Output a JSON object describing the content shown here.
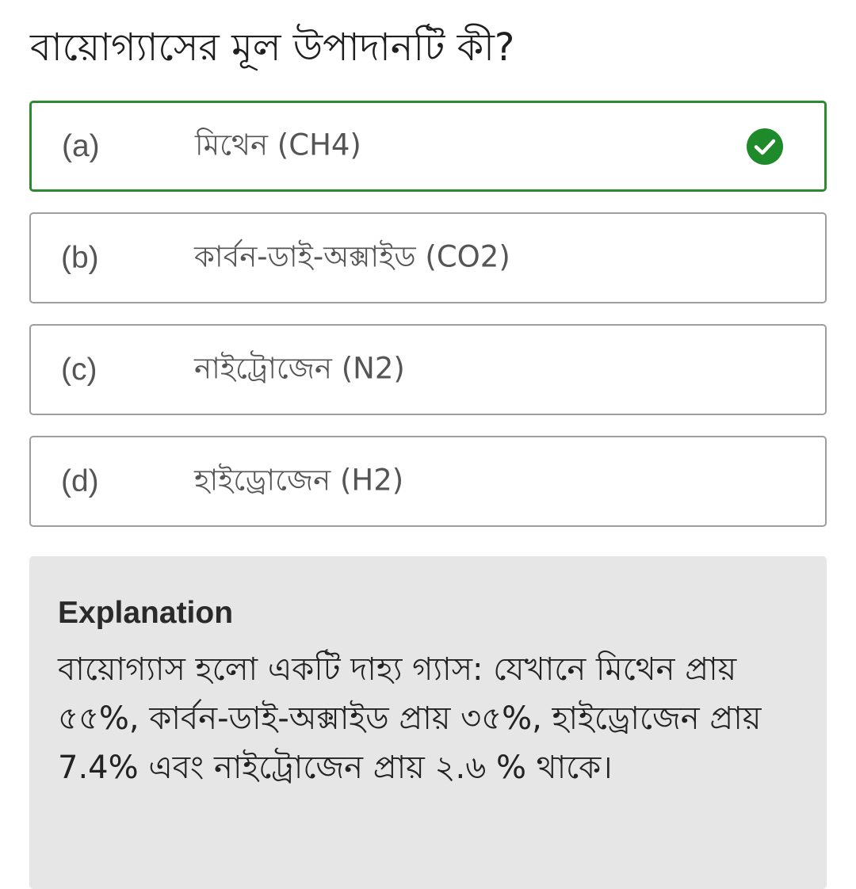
{
  "question": "বায়োগ্যাসের মূল উপাদানটি কী?",
  "options": [
    {
      "letter": "(a)",
      "text": "মিথেন (CH4)",
      "correct": true
    },
    {
      "letter": "(b)",
      "text": "কার্বন-ডাই-অক্সাইড (CO2)",
      "correct": false
    },
    {
      "letter": "(c)",
      "text": "নাইট্রোজেন (N2)",
      "correct": false
    },
    {
      "letter": "(d)",
      "text": "হাইড্রোজেন (H2)",
      "correct": false
    }
  ],
  "explanation": {
    "title": "Explanation",
    "body": "বায়োগ্যাস হলো একটি দাহ্য গ্যাস: যেখানে মিথেন প্রায় ৫৫%, কার্বন-ডাই-অক্সাইড প্রায় ৩৫%, হাইড্রোজেন প্রায় 7.4%  এবং নাইট্রোজেন প্রায় ২.৬ % থাকে।"
  },
  "colors": {
    "correct_accent": "#2e8a2e",
    "option_border": "#9e9e9e",
    "explanation_bg": "#e6e6e6"
  },
  "icons": {
    "correct_marker": "check-circle-icon"
  }
}
